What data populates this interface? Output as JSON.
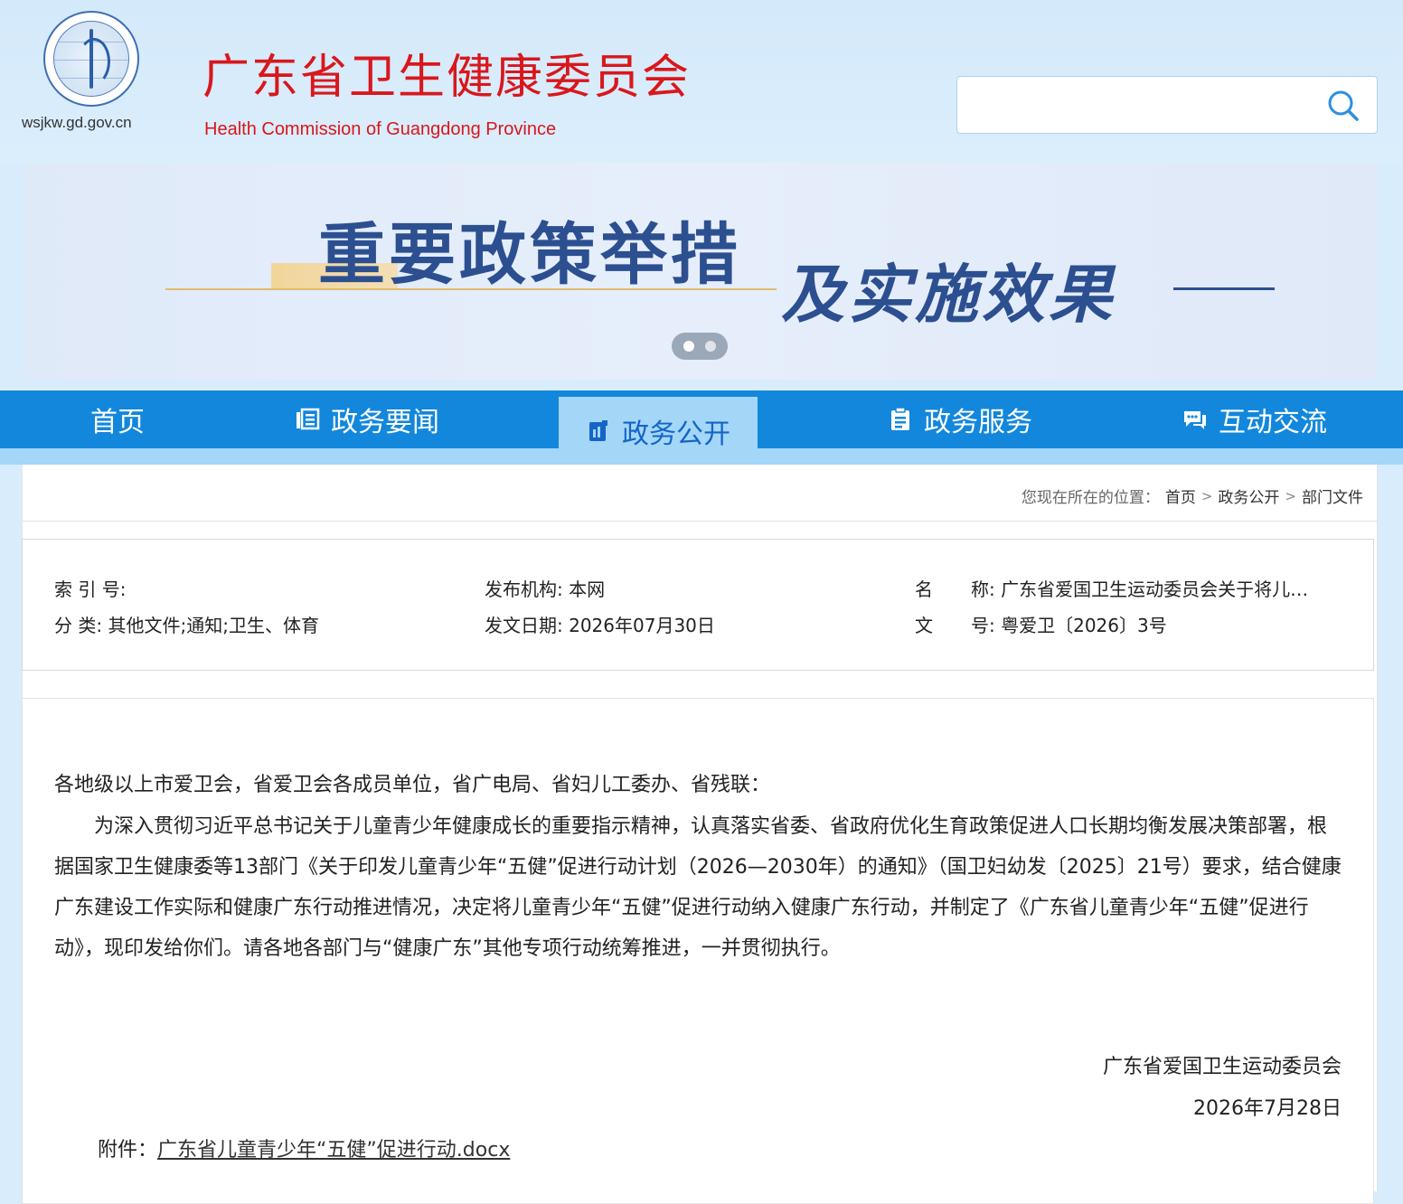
{
  "header": {
    "site_url": "wsjkw.gd.gov.cn",
    "title": "广东省卫生健康委员会",
    "subtitle": "Health Commission of Guangdong Province",
    "search_placeholder": "",
    "accent_color": "#d9171c"
  },
  "banner": {
    "line1": "重要政策举措",
    "line2": "及实施效果",
    "slides_total": 2,
    "active_slide": 1
  },
  "nav": {
    "items": [
      {
        "label": "首页",
        "icon": ""
      },
      {
        "label": "政务要闻",
        "icon": "news-icon"
      },
      {
        "label": "政务公开",
        "icon": "document-icon",
        "active": true
      },
      {
        "label": "政务服务",
        "icon": "clipboard-icon"
      },
      {
        "label": "互动交流",
        "icon": "chat-icon"
      }
    ],
    "color": "#1287dc",
    "active_color": "#a3d6f7"
  },
  "breadcrumb": {
    "prefix": "您现在所在的位置：",
    "items": [
      "首页",
      "政务公开",
      "部门文件"
    ],
    "sep": ">"
  },
  "meta": {
    "index_label": "索 引 号:",
    "index_value": "",
    "category_label": "分 类:",
    "category_value": "其他文件;通知;卫生、体育",
    "publisher_label": "发布机构:",
    "publisher_value": "本网",
    "date_label": "发文日期:",
    "date_value": "2026年07月30日",
    "name_label_a": "名",
    "name_label_b": "称:",
    "name_value": "广东省爱国卫生运动委员会关于将儿…",
    "docno_label_a": "文",
    "docno_label_b": "号:",
    "docno_value": "粤爱卫〔2026〕3号"
  },
  "article": {
    "salutation": "各地级以上市爱卫会，省爱卫会各成员单位，省广电局、省妇儿工委办、省残联：",
    "body": "为深入贯彻习近平总书记关于儿童青少年健康成长的重要指示精神，认真落实省委、省政府优化生育政策促进人口长期均衡发展决策部署，根据国家卫生健康委等13部门《关于印发儿童青少年“五健”促进行动计划（2026—2030年）的通知》（国卫妇幼发〔2025〕21号）要求，结合健康广东建设工作实际和健康广东行动推进情况，决定将儿童青少年“五健”促进行动纳入健康广东行动，并制定了《广东省儿童青少年“五健”促进行动》，现印发给你们。请各地各部门与“健康广东”其他专项行动统筹推进，一并贯彻执行。",
    "signer": "广东省爱国卫生运动委员会",
    "sign_date": "2026年7月28日",
    "attachment_label": "附件：",
    "attachment_link": "广东省儿童青少年“五健”促进行动.docx"
  }
}
